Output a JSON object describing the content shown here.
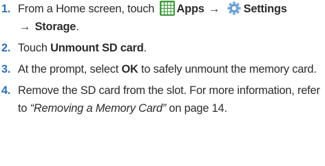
{
  "steps": [
    {
      "number": "1.",
      "parts": {
        "prefix": "From a Home screen, touch",
        "apps_label": "Apps",
        "arrow1": "→",
        "settings_label": "Settings",
        "arrow2": "→",
        "storage_label": "Storage",
        "suffix": "."
      }
    },
    {
      "number": "2.",
      "parts": {
        "prefix": "Touch",
        "target": "Unmount SD card",
        "suffix": "."
      }
    },
    {
      "number": "3.",
      "parts": {
        "prefix": "At the prompt, select",
        "target": "OK",
        "suffix": "to safely unmount the memory card."
      }
    },
    {
      "number": "4.",
      "parts": {
        "prefix": "Remove the SD card from the slot. For more information, refer to",
        "reference": "“Removing a Memory Card”",
        "suffix": "on page 14."
      }
    }
  ],
  "icons": {
    "apps": "apps-grid-icon",
    "settings": "settings-gear-icon"
  },
  "colors": {
    "step_number": "#2f6fb5",
    "apps_icon": "#3d9a3b",
    "settings_icon": "#6b9fd0"
  }
}
